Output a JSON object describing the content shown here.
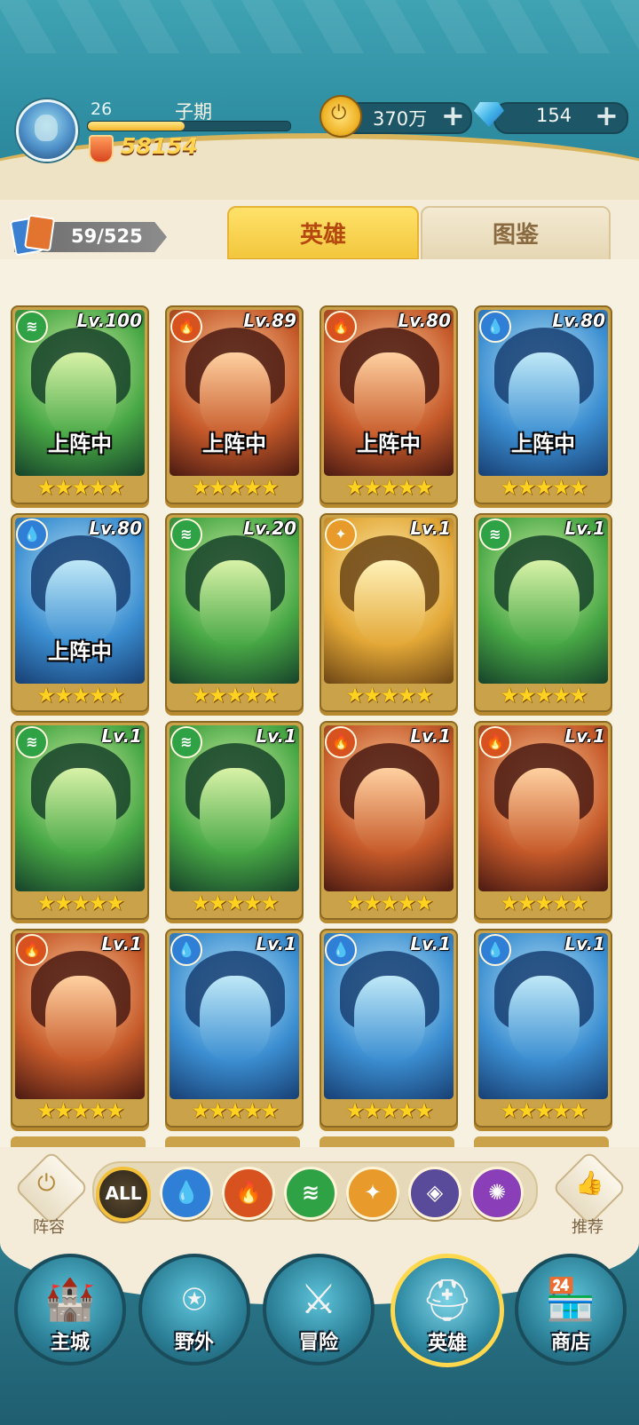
{
  "player": {
    "level": "26",
    "name": "子期",
    "power": "58154",
    "xp_fraction": 0.48
  },
  "resources": {
    "gold": "370万",
    "gems": "154",
    "plus": "+"
  },
  "hero_count": "59/525",
  "tabs": {
    "heroes": "英雄",
    "codex": "图鉴"
  },
  "on_team_label": "上阵中",
  "cards": [
    {
      "element": "nature",
      "level": "Lv.100",
      "on_team": true,
      "stars": 5
    },
    {
      "element": "fire",
      "level": "Lv.89",
      "on_team": true,
      "stars": 5
    },
    {
      "element": "fire",
      "level": "Lv.80",
      "on_team": true,
      "stars": 5
    },
    {
      "element": "water",
      "level": "Lv.80",
      "on_team": true,
      "stars": 5
    },
    {
      "element": "water",
      "level": "Lv.80",
      "on_team": true,
      "stars": 5
    },
    {
      "element": "nature",
      "level": "Lv.20",
      "on_team": false,
      "stars": 5
    },
    {
      "element": "light",
      "level": "Lv.1",
      "on_team": false,
      "stars": 5
    },
    {
      "element": "nature",
      "level": "Lv.1",
      "on_team": false,
      "stars": 5
    },
    {
      "element": "nature",
      "level": "Lv.1",
      "on_team": false,
      "stars": 5
    },
    {
      "element": "nature",
      "level": "Lv.1",
      "on_team": false,
      "stars": 5
    },
    {
      "element": "fire",
      "level": "Lv.1",
      "on_team": false,
      "stars": 5
    },
    {
      "element": "fire",
      "level": "Lv.1",
      "on_team": false,
      "stars": 5
    },
    {
      "element": "fire",
      "level": "Lv.1",
      "on_team": false,
      "stars": 5
    },
    {
      "element": "water",
      "level": "Lv.1",
      "on_team": false,
      "stars": 5
    },
    {
      "element": "water",
      "level": "Lv.1",
      "on_team": false,
      "stars": 5
    },
    {
      "element": "water",
      "level": "Lv.1",
      "on_team": false,
      "stars": 5
    }
  ],
  "filters": {
    "lineup_label": "阵容",
    "recommend_label": "推荐",
    "chips": [
      {
        "id": "all",
        "label": "ALL"
      },
      {
        "id": "water",
        "icon": "water-element-icon"
      },
      {
        "id": "fire",
        "icon": "fire-element-icon"
      },
      {
        "id": "nature",
        "icon": "nature-element-icon"
      },
      {
        "id": "light",
        "icon": "light-element-icon"
      },
      {
        "id": "dark",
        "icon": "dark-element-icon"
      },
      {
        "id": "arcane",
        "icon": "arcane-element-icon"
      }
    ]
  },
  "nav": [
    {
      "id": "main-city",
      "label": "主城",
      "icon": "castle-icon"
    },
    {
      "id": "wild",
      "label": "野外",
      "icon": "portal-icon"
    },
    {
      "id": "adventure",
      "label": "冒险",
      "icon": "sword-icon"
    },
    {
      "id": "heroes",
      "label": "英雄",
      "icon": "helmet-icon",
      "active": true
    },
    {
      "id": "shop",
      "label": "商店",
      "icon": "shop-icon"
    }
  ],
  "colors": {
    "water": "#2f7fd6",
    "fire": "#d8521f",
    "nature": "#2fa245",
    "light": "#e89a2a",
    "dark": "#5a4a9a",
    "arcane": "#8a3fb8"
  }
}
